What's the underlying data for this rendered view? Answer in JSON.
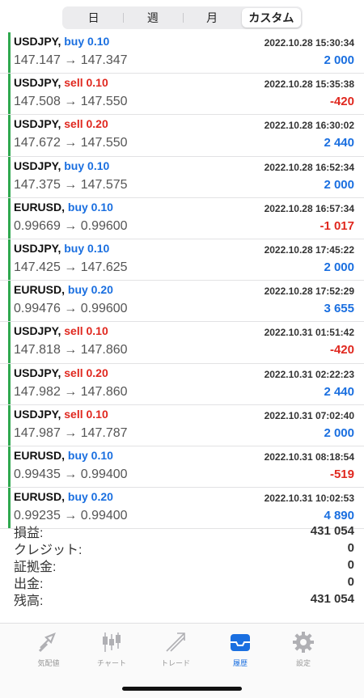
{
  "period_tabs": [
    {
      "label": "日",
      "active": false
    },
    {
      "label": "週",
      "active": false
    },
    {
      "label": "月",
      "active": false
    },
    {
      "label": "カスタム",
      "active": true
    }
  ],
  "trades": [
    {
      "symbol": "USDJPY,",
      "side": "buy",
      "volume": "buy 0.10",
      "time": "2022.10.28 15:30:34",
      "price": "147.147 → 147.347",
      "profit": "2 000"
    },
    {
      "symbol": "USDJPY,",
      "side": "sell",
      "volume": "sell 0.10",
      "time": "2022.10.28 15:35:38",
      "price": "147.508 → 147.550",
      "profit": "-420"
    },
    {
      "symbol": "USDJPY,",
      "side": "sell",
      "volume": "sell 0.20",
      "time": "2022.10.28 16:30:02",
      "price": "147.672 → 147.550",
      "profit": "2 440"
    },
    {
      "symbol": "USDJPY,",
      "side": "buy",
      "volume": "buy 0.10",
      "time": "2022.10.28 16:52:34",
      "price": "147.375 → 147.575",
      "profit": "2 000"
    },
    {
      "symbol": "EURUSD,",
      "side": "buy",
      "volume": "buy 0.10",
      "time": "2022.10.28 16:57:34",
      "price": "0.99669 → 0.99600",
      "profit": "-1 017"
    },
    {
      "symbol": "USDJPY,",
      "side": "buy",
      "volume": "buy 0.10",
      "time": "2022.10.28 17:45:22",
      "price": "147.425 → 147.625",
      "profit": "2 000"
    },
    {
      "symbol": "EURUSD,",
      "side": "buy",
      "volume": "buy 0.20",
      "time": "2022.10.28 17:52:29",
      "price": "0.99476 → 0.99600",
      "profit": "3 655"
    },
    {
      "symbol": "USDJPY,",
      "side": "sell",
      "volume": "sell 0.10",
      "time": "2022.10.31 01:51:42",
      "price": "147.818 → 147.860",
      "profit": "-420"
    },
    {
      "symbol": "USDJPY,",
      "side": "sell",
      "volume": "sell 0.20",
      "time": "2022.10.31 02:22:23",
      "price": "147.982 → 147.860",
      "profit": "2 440"
    },
    {
      "symbol": "USDJPY,",
      "side": "sell",
      "volume": "sell 0.10",
      "time": "2022.10.31 07:02:40",
      "price": "147.987 → 147.787",
      "profit": "2 000"
    },
    {
      "symbol": "EURUSD,",
      "side": "buy",
      "volume": "buy 0.10",
      "time": "2022.10.31 08:18:54",
      "price": "0.99435 → 0.99400",
      "profit": "-519"
    },
    {
      "symbol": "EURUSD,",
      "side": "buy",
      "volume": "buy 0.20",
      "time": "2022.10.31 10:02:53",
      "price": "0.99235 → 0.99400",
      "profit": "4 890"
    }
  ],
  "summary": [
    {
      "label": "損益:",
      "value": "431 054"
    },
    {
      "label": "クレジット:",
      "value": "0"
    },
    {
      "label": "証拠金:",
      "value": "0"
    },
    {
      "label": "出金:",
      "value": "0"
    },
    {
      "label": "残高:",
      "value": "431 054"
    }
  ],
  "tabbar": [
    {
      "label": "気配値",
      "icon": "quotes-icon",
      "active": false
    },
    {
      "label": "チャート",
      "icon": "chart-icon",
      "active": false
    },
    {
      "label": "トレード",
      "icon": "trade-icon",
      "active": false
    },
    {
      "label": "履歴",
      "icon": "history-icon",
      "active": true
    },
    {
      "label": "設定",
      "icon": "settings-icon",
      "active": false
    }
  ],
  "colors": {
    "buy": "#1a6fe0",
    "sell": "#e0281f",
    "profit_positive": "#1a6fe0",
    "profit_negative": "#e0281f",
    "row_marker": "#2fa84f",
    "tab_active": "#1a6fe0",
    "tab_inactive": "#999999"
  }
}
